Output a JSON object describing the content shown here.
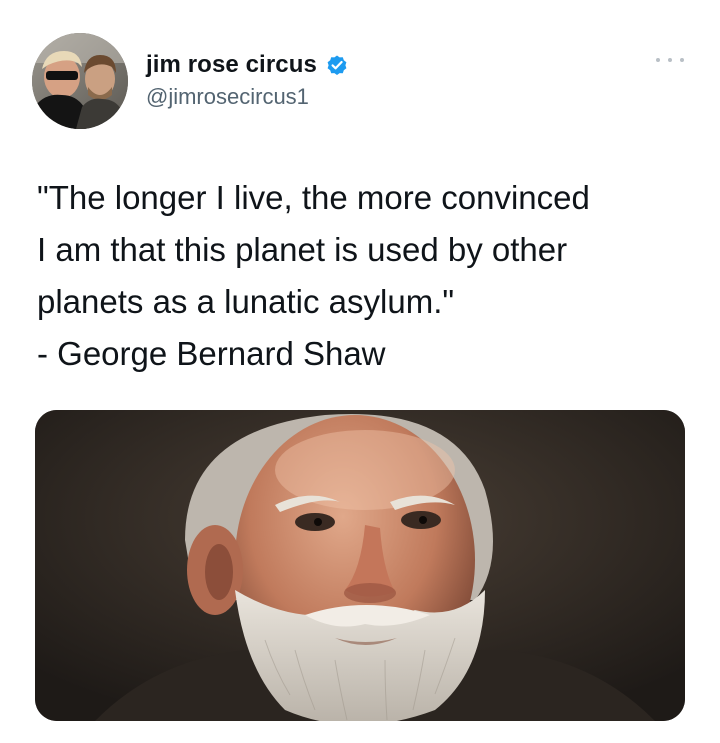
{
  "tweet": {
    "author": {
      "display_name": "jim rose circus",
      "handle": "@jimrosecircus1",
      "verified": true,
      "verified_color": "#1d9bf0"
    },
    "text_lines": [
      "\"The longer I live, the more convinced",
      "I am that this planet is used by other",
      "planets as a lunatic asylum.\"",
      "- George Bernard Shaw"
    ],
    "icons": {
      "more": "more-options-icon",
      "verified": "verified-badge-icon"
    }
  }
}
